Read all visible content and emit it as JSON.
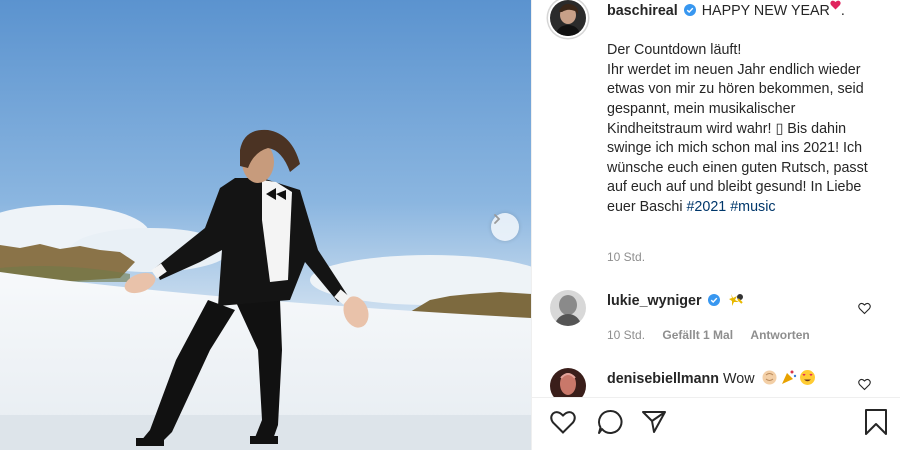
{
  "post": {
    "next_label": "›",
    "caption": {
      "username": "baschireal",
      "heading": "HAPPY NEW YEAR",
      "body": "Der Countdown läuft!\nIhr werdet im neuen Jahr endlich wieder etwas von mir zu hören bekommen, seid gespannt, mein musikalischer Kindheitstraum wird wahr! ▯ Bis dahin swinge ich mich schon mal ins 2021! Ich wünsche euch einen guten Rutsch, passt auf euch auf und bleibt gesund! In Liebe euer Baschi ",
      "hashtags": [
        "#2021",
        "#music"
      ],
      "time": "10 Std."
    },
    "comments": [
      {
        "username": "lukie_wyniger",
        "text": "",
        "emoji": [
          "sparkle-bee-icon"
        ],
        "time": "10 Std.",
        "likes": "Gefällt 1 Mal",
        "reply": "Antworten"
      },
      {
        "username": "denisebiellmann",
        "text": "Wow",
        "emoji": [
          "clap-icon",
          "party-popper-icon",
          "heart-eyes-icon"
        ]
      }
    ],
    "actions": [
      "like-icon",
      "comment-icon",
      "share-icon",
      "save-icon"
    ],
    "colors": {
      "verified": "#3897f0",
      "hashtag": "#00376b",
      "muted": "#8e8e8e"
    }
  }
}
